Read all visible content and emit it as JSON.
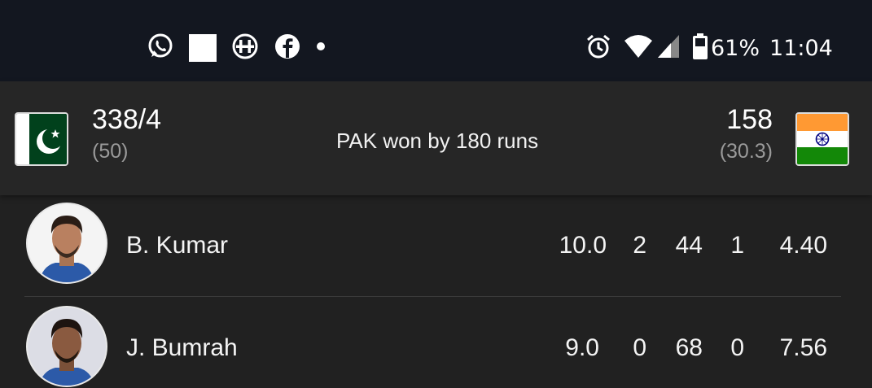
{
  "status_bar": {
    "left_icons": [
      "whatsapp-icon",
      "square-notification-icon",
      "hotstar-icon",
      "facebook-icon",
      "more-dot-icon"
    ],
    "right_icons": [
      "alarm-icon",
      "wifi-icon",
      "signal-icon",
      "battery-icon"
    ],
    "battery": "61%",
    "time": "11:04"
  },
  "match": {
    "team1": {
      "name": "PAK",
      "flag": "pakistan-flag-icon",
      "score": "338/4",
      "overs": "(50)"
    },
    "team2": {
      "name": "IND",
      "flag": "india-flag-icon",
      "score": "158",
      "overs": "(30.3)"
    },
    "result": "PAK won by 180 runs"
  },
  "bowlers": [
    {
      "name": "B. Kumar",
      "overs": "10.0",
      "maidens": "2",
      "runs": "44",
      "wickets": "1",
      "economy": "4.40"
    },
    {
      "name": "J. Bumrah",
      "overs": "9.0",
      "maidens": "0",
      "runs": "68",
      "wickets": "0",
      "economy": "7.56"
    }
  ],
  "colors": {
    "status_bar_bg": "#131720",
    "header_bg": "#262626",
    "list_bg": "#212121",
    "pak_green": "#01411C",
    "ind_saffron": "#FF9933",
    "ind_green": "#138808",
    "chakra_blue": "#000080"
  }
}
